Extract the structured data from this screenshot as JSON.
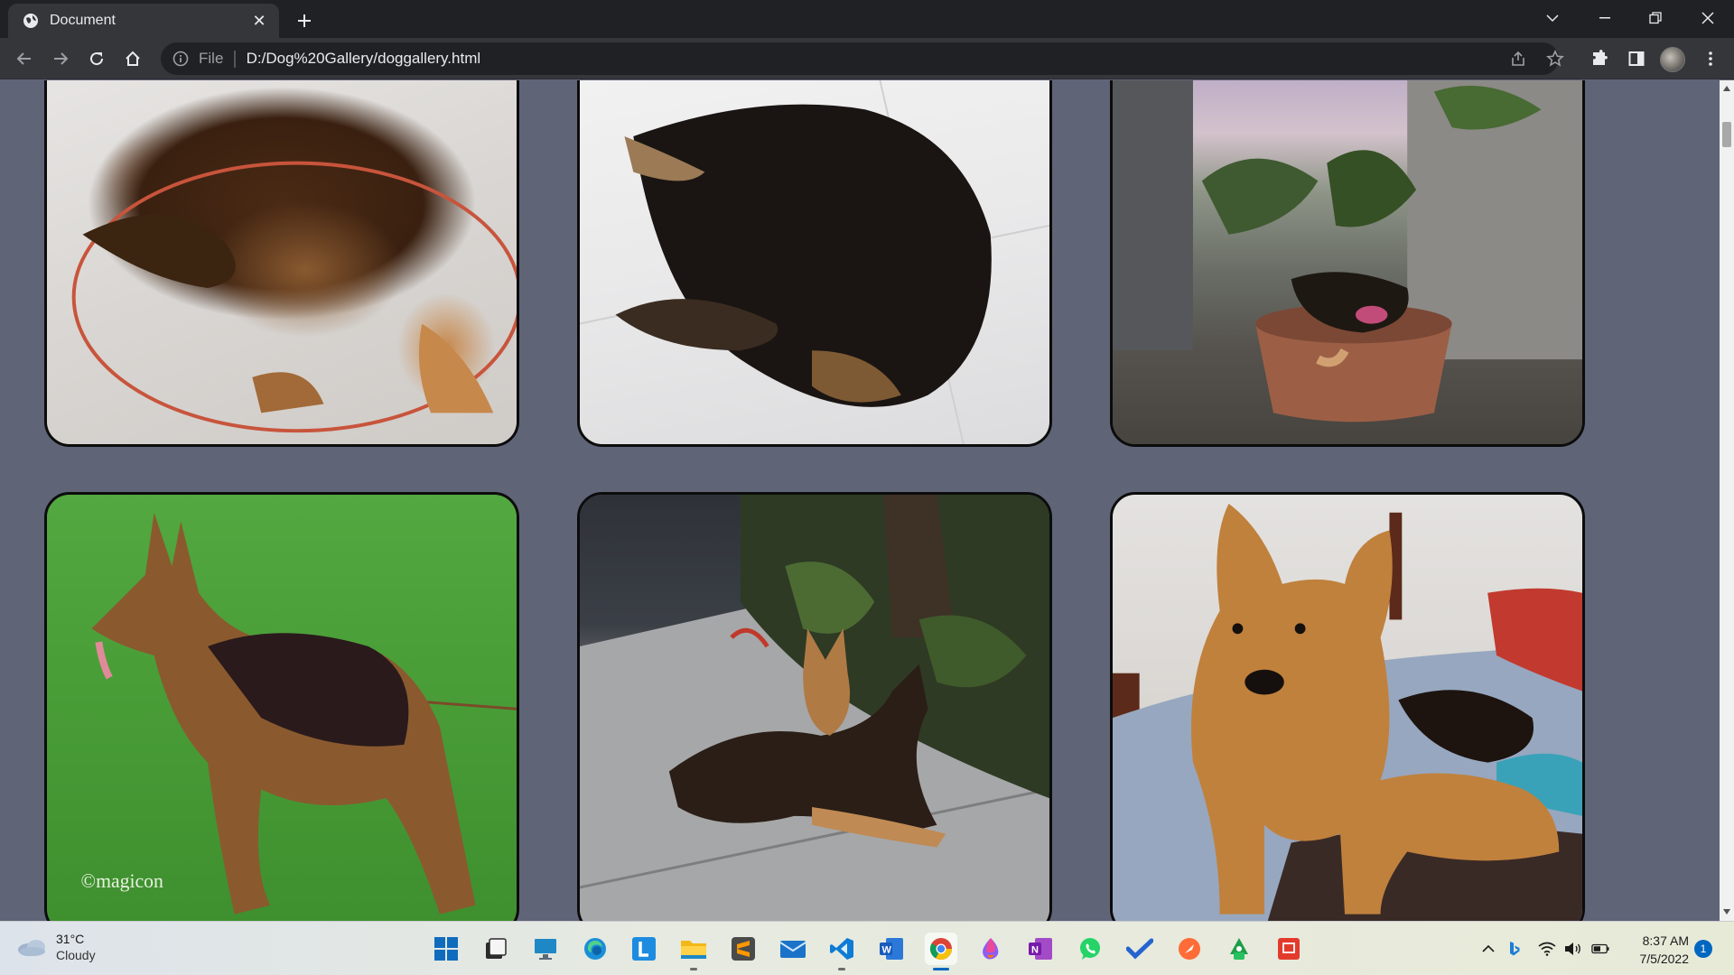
{
  "browser": {
    "tab_title": "Document",
    "address_scheme": "File",
    "address_url": "D:/Dog%20Gallery/doggallery.html"
  },
  "gallery": {
    "images": [
      {
        "description": "puppy-lying-on-mat"
      },
      {
        "description": "puppy-sleeping-on-tiles"
      },
      {
        "description": "puppy-sitting-in-pot"
      },
      {
        "description": "standing-german-shepherd-on-grass"
      },
      {
        "description": "german-shepherd-lying-on-sidewalk"
      },
      {
        "description": "german-shepherd-lying-on-bed"
      }
    ],
    "watermark": "©magicon"
  },
  "taskbar": {
    "weather_temp": "31°C",
    "weather_condition": "Cloudy",
    "time": "8:37 AM",
    "date": "7/5/2022",
    "notification_count": "1"
  }
}
